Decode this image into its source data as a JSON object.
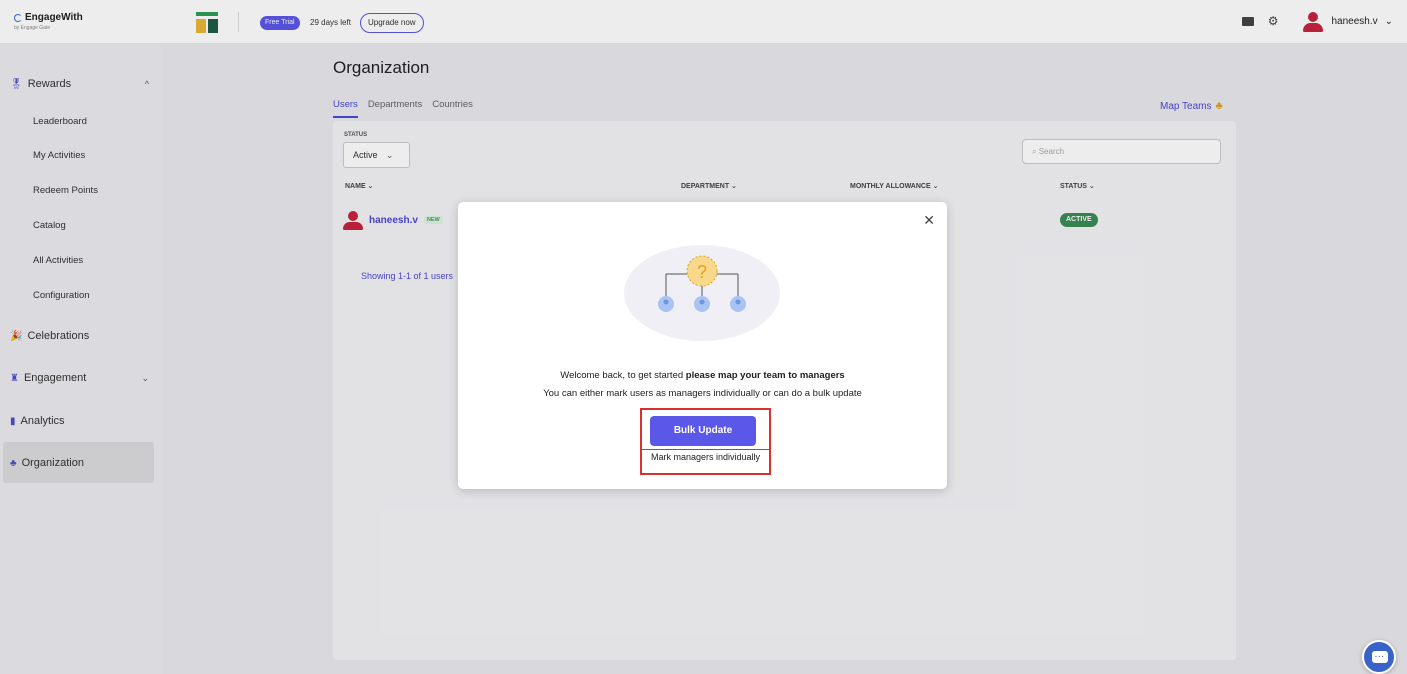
{
  "brand": {
    "name": "EngageWith",
    "tagline": "by Engage Gate"
  },
  "topbar": {
    "trial_badge": "Free Trial",
    "trial_days": "29 days left",
    "upgrade_label": "Upgrade now",
    "user_name": "haneesh.v",
    "accent": "#5b57e8"
  },
  "sidebar": {
    "rewards": "Rewards",
    "rewards_items": [
      "Leaderboard",
      "My Activities",
      "Redeem Points",
      "Catalog",
      "All Activities",
      "Configuration"
    ],
    "celebrations": "Celebrations",
    "engagement": "Engagement",
    "analytics": "Analytics",
    "organization": "Organization"
  },
  "main": {
    "title": "Organization",
    "tabs": [
      "Users",
      "Departments",
      "Countries"
    ],
    "map_teams": "Map Teams",
    "status_label": "STATUS",
    "status_value": "Active",
    "search_placeholder": "Search",
    "columns": [
      "NAME ⌄",
      "DEPARTMENT ⌄",
      "MONTHLY ALLOWANCE ⌄",
      "STATUS ⌄"
    ],
    "row": {
      "name": "haneesh.v",
      "badge": "NEW",
      "status": "ACTIVE"
    },
    "showing": "Showing 1-1 of 1 users"
  },
  "modal": {
    "line1_prefix": "Welcome back, to get started ",
    "line1_bold": "please map your team to managers",
    "line2": "You can either mark users as managers individually or can do a bulk update",
    "bulk_update": "Bulk Update",
    "mark_individually": "Mark managers individually",
    "highlight_color": "#d9312b"
  }
}
